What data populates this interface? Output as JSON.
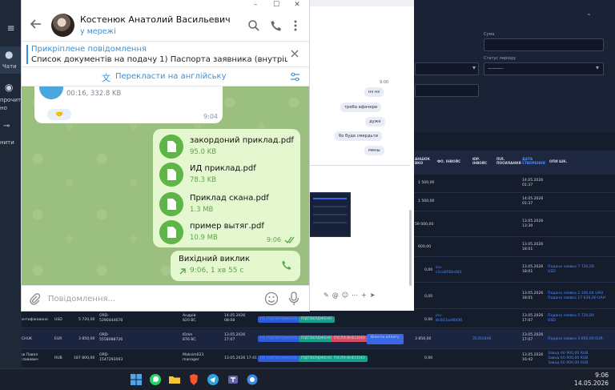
{
  "telegram": {
    "contact_name": "Костенюк Анатолий Васильевич",
    "contact_status": "у мережі",
    "pinned": {
      "title": "Прикріплене повідомлення",
      "text": "Список документів на подачу  1) Паспорта заявника (внутрішній і зак..."
    },
    "translate_label": "Перекласти на англійську",
    "incoming": {
      "meta": "00:16, 332.8 KB",
      "time": "9:04"
    },
    "files": [
      {
        "name": "закордоний приклад.pdf",
        "size": "95.0 KB"
      },
      {
        "name": "ИД приклад.pdf",
        "size": "78.3 KB"
      },
      {
        "name": "Приклад скана.pdf",
        "size": "1.3 MB"
      },
      {
        "name": "пример вытяг.pdf",
        "size": "10.9 MB"
      }
    ],
    "files_time": "9:06",
    "call": {
      "title": "Вихідний виклик",
      "meta": "9:06, 1 хв 55 с"
    },
    "input_placeholder": "Повідомлення..."
  },
  "sidebar": {
    "items": [
      "Чати",
      "прочит\nно",
      "нити"
    ]
  },
  "mid_chat": {
    "time": "9:00",
    "messages": [
      "нэ нэ",
      "треба афачери",
      "дуже",
      "бо буде смердьти",
      "мены"
    ]
  },
  "bg_app": {
    "filter_labels": [
      "Сума",
      "Статус періоду"
    ],
    "filter_value": "---------",
    "columns": [
      "АНШОК\nВКО",
      "ФО. ІНВОЙС",
      "ЮР.\nІНВОЙС",
      "ПІЛ.\nПОСИЛАННЯ",
      "ДАТА\nСТВОРЕННЯ",
      "ОПИ ШК."
    ],
    "rows": [
      {
        "amount": "1 500,00",
        "date": "14.05.2026\n01:37",
        "link": "",
        "blue_right": ""
      },
      {
        "amount": "1 500,00",
        "date": "14.05.2026\n01:37",
        "link": "",
        "blue_right": ""
      },
      {
        "amount": "59 000,00",
        "date": "13.05.2026\n13:39",
        "link": "",
        "blue_right": ""
      },
      {
        "amount": "600,00",
        "date": "13.05.2026\n18:01",
        "link": "",
        "blue_right": ""
      },
      {
        "amount": "0,00",
        "date": "13.05.2026\n18:01",
        "link": "inv-\nc1ca0f30e481",
        "blue_right": "Подана заявка 7 720,00\nUSD"
      },
      {
        "amount": "0,00",
        "date": "13.05.2026\n18:01",
        "link": "",
        "blue_right": "Подана заявка 2 346,04 UAH\nПодана заявка 17 636,00 UAH"
      }
    ],
    "bottom_rows": [
      {
        "name": "Не ідентифіковано",
        "currency": "USD",
        "sum": "5 720,00",
        "ord": "ORD-\n5390444678",
        "person": "Андрій\n820 ВС",
        "created": "14.05.2026\n08:08",
        "inv": "inv-\n8c003aa9bf36",
        "amount": "0,00",
        "date": "13.05.2026\n17:07",
        "desc": "Подана заявка 5 720,00\nUSD"
      },
      {
        "name": "YERMCHUK",
        "currency": "EUR",
        "sum": "3 850,00",
        "ord": "ORD-\n5558088726",
        "person": "Юлія\n876 ВС",
        "created": "13.05.2026\n17:07",
        "inv": "",
        "sum2": "3 850,00",
        "dec": "35350446",
        "amount": "0,00",
        "date": "13.05.2026\n17:07",
        "desc": "Подана заявка 3 850,00 EUR"
      },
      {
        "name": "Волков Павел\nВячеславович",
        "currency": "RUB",
        "sum": "187 800,00",
        "ord": "ORD-\n1547293093",
        "person": "Maksim023\nmanager",
        "created": "13.05.2026 17:41",
        "inv": "",
        "amount": "0,00",
        "date": "13.05.2026\n16:42",
        "desc": "Завод 60 900,00 RUB\nЗавод 60 900,00 RUB\nЗавод 60 900,00 RUB"
      }
    ],
    "pills": {
      "unpaid": "НЕ ПІДТВЕРДЖЕНО",
      "confirmed": "ПІДТВЕРДЖЕНО",
      "pending": "ПІСЛЯ ВНЕСЕНО"
    },
    "pay_button": "Внести оплату"
  },
  "taskbar": {
    "time": "9:06",
    "date": "14.05.2026"
  }
}
